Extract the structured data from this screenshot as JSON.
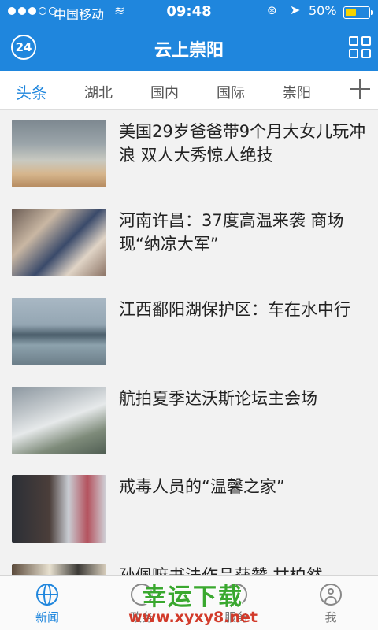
{
  "status_bar": {
    "carrier": "中国移动",
    "time": "09:48",
    "battery": "50%",
    "battery_level": 0.5,
    "signal_dots": [
      true,
      true,
      true,
      false,
      false
    ]
  },
  "header": {
    "title": "云上崇阳",
    "logo_text": "24"
  },
  "tabs": [
    {
      "label": "头条",
      "active": true
    },
    {
      "label": "湖北",
      "active": false
    },
    {
      "label": "国内",
      "active": false
    },
    {
      "label": "国际",
      "active": false
    },
    {
      "label": "崇阳",
      "active": false
    }
  ],
  "news": [
    {
      "headline": "美国29岁爸爸带9个月大女儿玩冲浪 双人大秀惊人绝技"
    },
    {
      "headline": "河南许昌：37度高温来袭 商场现“纳凉大军”"
    },
    {
      "headline": "江西鄱阳湖保护区：车在水中行"
    },
    {
      "headline": "航拍夏季达沃斯论坛主会场"
    },
    {
      "headline": "戒毒人员的“温馨之家”"
    },
    {
      "headline": "孙佩嘛书法作品获赞 甘柏然"
    }
  ],
  "bottom_nav": [
    {
      "label": "新闻",
      "icon": "globe-icon",
      "active": true
    },
    {
      "label": "政务",
      "icon": "government-icon",
      "active": false
    },
    {
      "label": "服务",
      "icon": "service-icon",
      "active": false
    },
    {
      "label": "我",
      "icon": "person-icon",
      "active": false
    }
  ],
  "watermark": {
    "text": "幸运下载",
    "url": "www.xyxy8.net"
  },
  "colors": {
    "brand_blue": "#1f86dd",
    "battery_yellow": "#f5d300"
  }
}
